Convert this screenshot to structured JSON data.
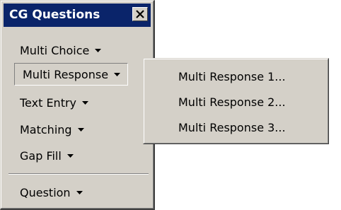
{
  "window": {
    "title": "CG Questions",
    "close_icon": "close-icon"
  },
  "menu": {
    "items": [
      {
        "label": "Multi Choice",
        "icon": "chevron-down-icon"
      },
      {
        "label": "Multi Response",
        "icon": "chevron-down-icon",
        "state": "pressed"
      },
      {
        "label": "Text Entry",
        "icon": "chevron-down-icon"
      },
      {
        "label": "Matching",
        "icon": "chevron-down-icon"
      },
      {
        "label": "Gap Fill",
        "icon": "chevron-down-icon"
      },
      {
        "label": "Question",
        "icon": "chevron-down-icon"
      }
    ]
  },
  "submenu": {
    "items": [
      {
        "label": "Multi Response 1..."
      },
      {
        "label": "Multi Response 2..."
      },
      {
        "label": "Multi Response 3..."
      }
    ]
  },
  "colors": {
    "face": "#d4d0c8",
    "titlebar": "#0a246a",
    "highlight": "#ffffff",
    "shadow": "#808080"
  }
}
